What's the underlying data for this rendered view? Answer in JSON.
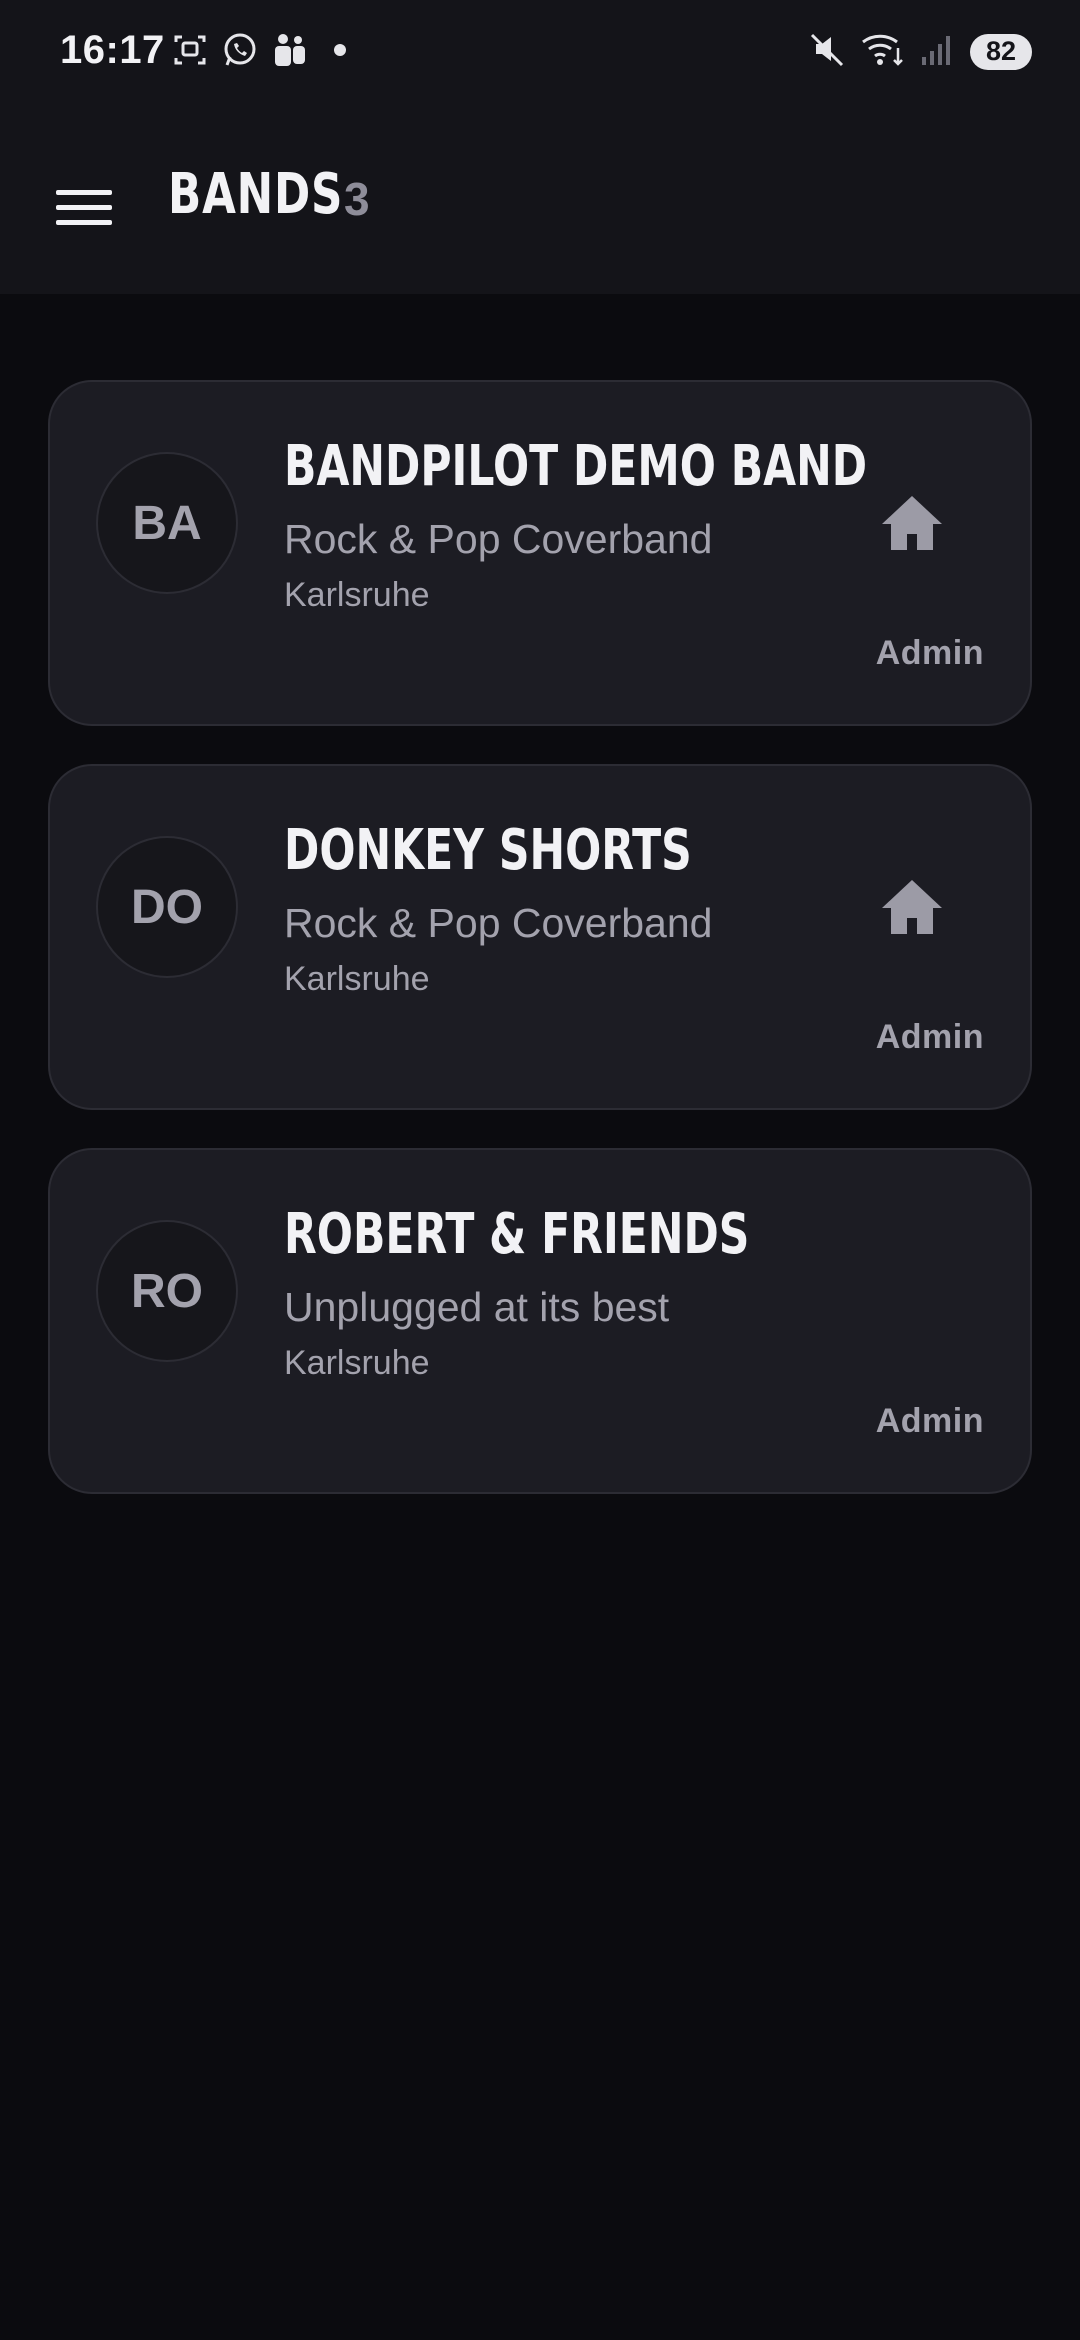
{
  "status_bar": {
    "time": "16:17",
    "battery": "82",
    "icons_left": [
      "screenshot-icon",
      "whatsapp-icon",
      "teams-icon",
      "notification-dot-icon"
    ],
    "icons_right": [
      "mute-icon",
      "wifi-icon",
      "signal-icon"
    ]
  },
  "header": {
    "title": "BANDS",
    "count": "3",
    "menu_icon": "hamburger-menu-icon"
  },
  "bands": [
    {
      "initials": "BA",
      "name": "BANDPILOT DEMO BAND",
      "genre": "Rock & Pop Coverband",
      "city": "Karlsruhe",
      "role": "Admin",
      "home": true
    },
    {
      "initials": "DO",
      "name": "DONKEY SHORTS",
      "genre": "Rock & Pop Coverband",
      "city": "Karlsruhe",
      "role": "Admin",
      "home": true
    },
    {
      "initials": "RO",
      "name": "ROBERT & FRIENDS",
      "genre": "Unplugged at its best",
      "city": "Karlsruhe",
      "role": "Admin",
      "home": false
    }
  ],
  "colors": {
    "background": "#0b0b0f",
    "app_bar": "#141419",
    "card": "#1c1c23",
    "muted_text": "#a3a2ad",
    "icon": "#9c9ba6"
  }
}
